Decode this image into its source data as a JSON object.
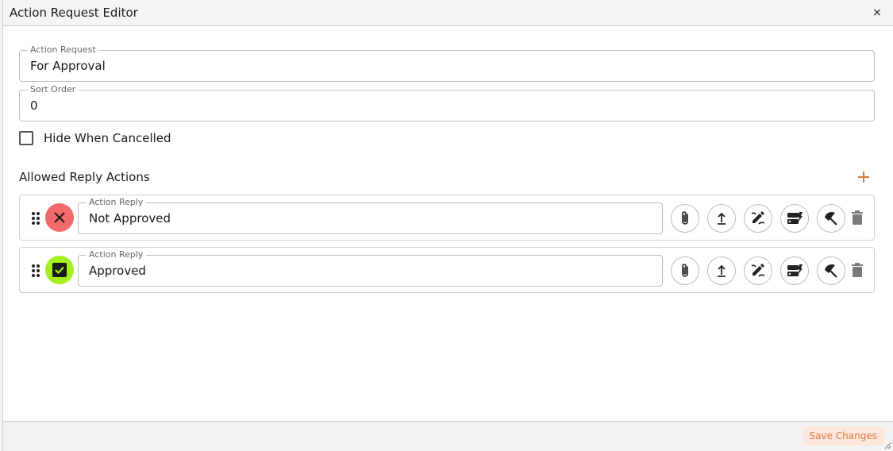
{
  "window": {
    "title": "Action Request Editor",
    "close_glyph": "×"
  },
  "form": {
    "action_request": {
      "label": "Action Request",
      "value": "For Approval"
    },
    "sort_order": {
      "label": "Sort Order",
      "value": "0"
    },
    "hide_when_cancelled": {
      "label": "Hide When Cancelled",
      "checked": false
    }
  },
  "replies_section": {
    "title": "Allowed Reply Actions",
    "add_icon": "plus-icon",
    "items": [
      {
        "label": "Action Reply",
        "value": "Not Approved",
        "status_icon": "x-icon",
        "status_color": "#f26a6a"
      },
      {
        "label": "Action Reply",
        "value": "Approved",
        "status_icon": "checkbox-checked-icon",
        "status_color": "#a6f01f"
      }
    ],
    "row_actions": [
      "paperclip-icon",
      "upload-icon",
      "edit-note-icon",
      "storage-bolt-icon",
      "beach-access-icon",
      "trash-icon"
    ]
  },
  "footer": {
    "save_label": "Save Changes"
  },
  "colors": {
    "accent": "#e0793f",
    "save_bg": "#fbe6dc"
  }
}
